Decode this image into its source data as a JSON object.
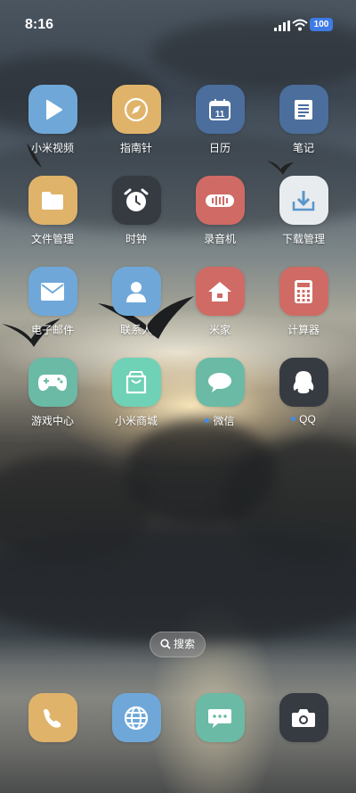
{
  "status_bar": {
    "time": "8:16",
    "battery": "100"
  },
  "apps": [
    {
      "label": "小米视频",
      "icon": "play-icon",
      "color": "#6fa8d8"
    },
    {
      "label": "指南针",
      "icon": "compass-icon",
      "color": "#e0b36a"
    },
    {
      "label": "日历",
      "icon": "calendar-icon",
      "color": "#4b6e9c",
      "calendar_day": "11"
    },
    {
      "label": "笔记",
      "icon": "notes-icon",
      "color": "#4b6e9c"
    },
    {
      "label": "文件管理",
      "icon": "folder-icon",
      "color": "#e0b36a"
    },
    {
      "label": "时钟",
      "icon": "clock-icon",
      "color": "#363b42"
    },
    {
      "label": "录音机",
      "icon": "waveform-icon",
      "color": "#d06a64"
    },
    {
      "label": "下载管理",
      "icon": "download-icon",
      "color": "#e8ecef"
    },
    {
      "label": "电子邮件",
      "icon": "mail-icon",
      "color": "#6fa8d8"
    },
    {
      "label": "联系人",
      "icon": "contact-icon",
      "color": "#6fa8d8"
    },
    {
      "label": "米家",
      "icon": "home-icon",
      "color": "#d06a64"
    },
    {
      "label": "计算器",
      "icon": "calculator-icon",
      "color": "#d06a64"
    },
    {
      "label": "游戏中心",
      "icon": "gamepad-icon",
      "color": "#6bbaa5"
    },
    {
      "label": "小米商城",
      "icon": "shopping-bag-icon",
      "color": "#6fd1b5"
    },
    {
      "label": "微信",
      "icon": "chat-bubble-icon",
      "color": "#6bbaa5",
      "new_badge": true
    },
    {
      "label": "QQ",
      "icon": "penguin-icon",
      "color": "#363b42",
      "new_badge": true
    }
  ],
  "search": {
    "label": "搜索"
  },
  "dock": [
    {
      "icon": "phone-icon",
      "color": "#e0b36a"
    },
    {
      "icon": "globe-icon",
      "color": "#6fa8d8"
    },
    {
      "icon": "message-icon",
      "color": "#6bbaa5"
    },
    {
      "icon": "camera-icon",
      "color": "#363b42"
    }
  ]
}
